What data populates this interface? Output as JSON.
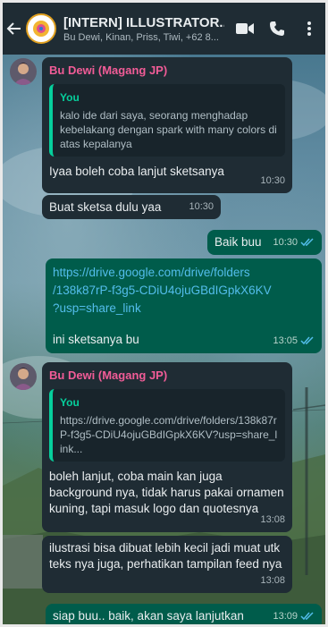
{
  "header": {
    "title": "[INTERN] ILLUSTRATOR...",
    "subtitle": "Bu Dewi, Kinan, Priss, Tiwi, +62 8..."
  },
  "messages": [
    {
      "sender": "Bu Dewi (Magang JP)",
      "quote_name": "You",
      "quote_text": "kalo ide dari saya,  seorang menghadap kebelakang dengan spark with many colors di atas kepalanya",
      "text": "Iyaa boleh coba lanjut sketsanya",
      "time": "10:30"
    },
    {
      "text": "Buat sketsa dulu yaa",
      "time": "10:30"
    },
    {
      "text": "Baik buu",
      "time": "10:30"
    },
    {
      "link": "https://drive.google.com/drive/folders/138k87rP-f3g5-CDiU4ojuGBdIGpkX6KV?usp=share_link",
      "link_lines": [
        "https://drive.google.com/drive/folders",
        "/138k87rP-f3g5-CDiU4ojuGBdIGpkX6KV",
        "?usp=share_link"
      ],
      "text": "ini sketsanya bu",
      "time": "13:05"
    },
    {
      "sender": "Bu Dewi (Magang JP)",
      "quote_name": "You",
      "quote_text": "https://drive.google.com/drive/folders/138k87rP-f3g5-CDiU4ojuGBdIGpkX6KV?usp=share_link...",
      "text": "boleh lanjut, coba main kan juga background nya, tidak harus pakai ornamen kuning, tapi masuk logo dan quotesnya",
      "time": "13:08"
    },
    {
      "text": "ilustrasi bisa dibuat lebih kecil jadi muat utk teks nya juga, perhatikan tampilan feed nya",
      "time": "13:08"
    },
    {
      "text": "siap buu.. baik, akan saya lanjutkan",
      "time": "13:09"
    }
  ],
  "colors": {
    "header_bg": "#1f2c34",
    "incoming_bubble": "#1f2c34",
    "outgoing_bubble": "#005c4b",
    "sender_name": "#f15c97",
    "quote_accent": "#06cf9c",
    "link": "#53bdeb",
    "read_ticks": "#53bdeb"
  },
  "icons": [
    "back-arrow-icon",
    "group-avatar",
    "video-call-icon",
    "voice-call-icon",
    "more-options-icon",
    "avatar-icon",
    "read-ticks-icon"
  ]
}
